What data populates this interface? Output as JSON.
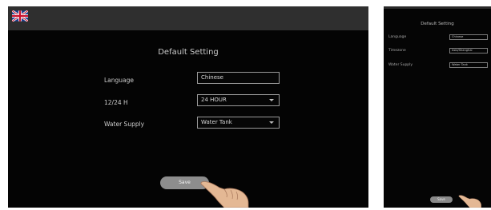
{
  "main_screen": {
    "title": "Default Setting",
    "rows": [
      {
        "label": "Language",
        "value": "Chinese",
        "dropdown": false
      },
      {
        "label": "12/24 H",
        "value": "24 HOUR",
        "dropdown": true
      },
      {
        "label": "Water Supply",
        "value": "Water Tank",
        "dropdown": true
      }
    ],
    "save_label": "Save",
    "flag_icon": "uk-flag-icon"
  },
  "side_screen": {
    "title": "Default Setting",
    "rows": [
      {
        "label": "Language",
        "value": "Chinese"
      },
      {
        "label": "Timezone",
        "value": "Asia/Shanghai"
      },
      {
        "label": "Water Supply",
        "value": "Water Tank"
      }
    ],
    "save_label": "Save"
  },
  "colors": {
    "screen_bg": "#040404",
    "topbar_bg": "#2f2f2f",
    "button_bg": "#8d8d8d"
  }
}
